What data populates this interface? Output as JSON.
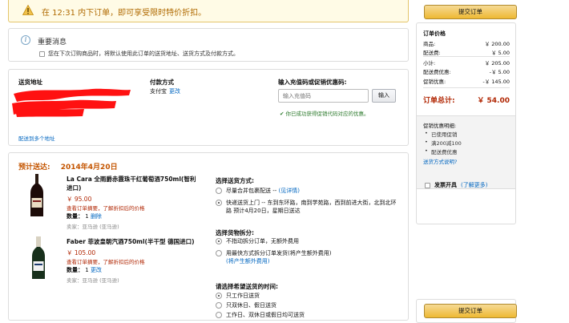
{
  "warning": {
    "text": "在 12:31 内下订单，即可享受限时特价折扣。"
  },
  "info": {
    "title": "重要消息",
    "checkbox_label": "您在下次订购商品时，将默认使用此订单的送货地址、送货方式及付款方式。"
  },
  "address": {
    "label": "送货地址",
    "multi_link": "配送到多个地址",
    "payment_label": "付款方式",
    "payment_value": "支付宝",
    "payment_change": "更改",
    "promo_label": "输入充值码或促销优惠码:",
    "promo_placeholder": "输入充值码",
    "promo_button": "输入",
    "promo_success": "你已成功获得促销代码对应的优惠。"
  },
  "shipping": {
    "estimate_label": "预计送达:",
    "estimate_date": "2014年4月20日",
    "products": [
      {
        "title_line1": "La Cara 全雨爵赤霞珠干红葡萄酒750ml(智利",
        "title_line2": "进口)",
        "price": "￥ 95.00",
        "note": "查看订单摘要，了解折扣后的价格",
        "qty_label": "数量：",
        "qty": "1",
        "delete": "删除",
        "seller": "卖家：亚马逊 (亚马逊)"
      },
      {
        "title_line1": "Faber 菲波皇朝汽酒750ml(半干型 德国进口)",
        "title_line2": "",
        "price": "￥ 105.00",
        "note": "查看订单摘要，了解折扣后的价格",
        "qty_label": "数量：",
        "qty": "1",
        "delete": "更改",
        "seller": "卖家：亚马逊 (亚马逊)"
      }
    ],
    "method_title": "选择送货方式:",
    "methods": [
      {
        "text": "尽量合并包裹配送 -- ",
        "link": "(见详情)",
        "selected": false
      },
      {
        "text": "快递送货上门 -- 东到东环路，南到学苑路，西到前进大街，北到北环路 预计4月20日，星期日送达",
        "link": "",
        "selected": true
      }
    ],
    "split_title": "选择货物拆分:",
    "splits": [
      {
        "text": "不指动拆分订单，无额外费用",
        "link": "",
        "selected": true
      },
      {
        "text": "用最快方式拆分订单发货(将产生额外费用)",
        "link": "(将产生额外费用)",
        "selected": false
      }
    ],
    "time_title": "请选择希望送货的时间:",
    "times": [
      {
        "text": "只工作日送货",
        "selected": true
      },
      {
        "text": "只双休日、假日送货",
        "selected": false
      },
      {
        "text": "工作日、双休日或假日均可送货",
        "selected": false
      }
    ]
  },
  "summary": {
    "submit": "提交订单",
    "title": "订单价格",
    "rows": [
      {
        "label": "商品:",
        "value": "￥ 200.00"
      },
      {
        "label": "配送费:",
        "value": "￥ 5.00"
      },
      {
        "label": "小计:",
        "value": "￥ 205.00"
      },
      {
        "label": "配送费优惠:",
        "value": "-￥ 5.00"
      },
      {
        "label": "促销优惠:",
        "value": "-￥ 145.00"
      }
    ],
    "total_label": "订单总计:",
    "total_value": "￥ 54.00",
    "promo_details_title": "促销优惠明细:",
    "promo_items": [
      "已使用促销",
      "满200减100",
      "配送费优惠"
    ],
    "promo_link": "送货方式说明?",
    "invoice_label": "发票开具",
    "invoice_link": "(了解更多)"
  }
}
